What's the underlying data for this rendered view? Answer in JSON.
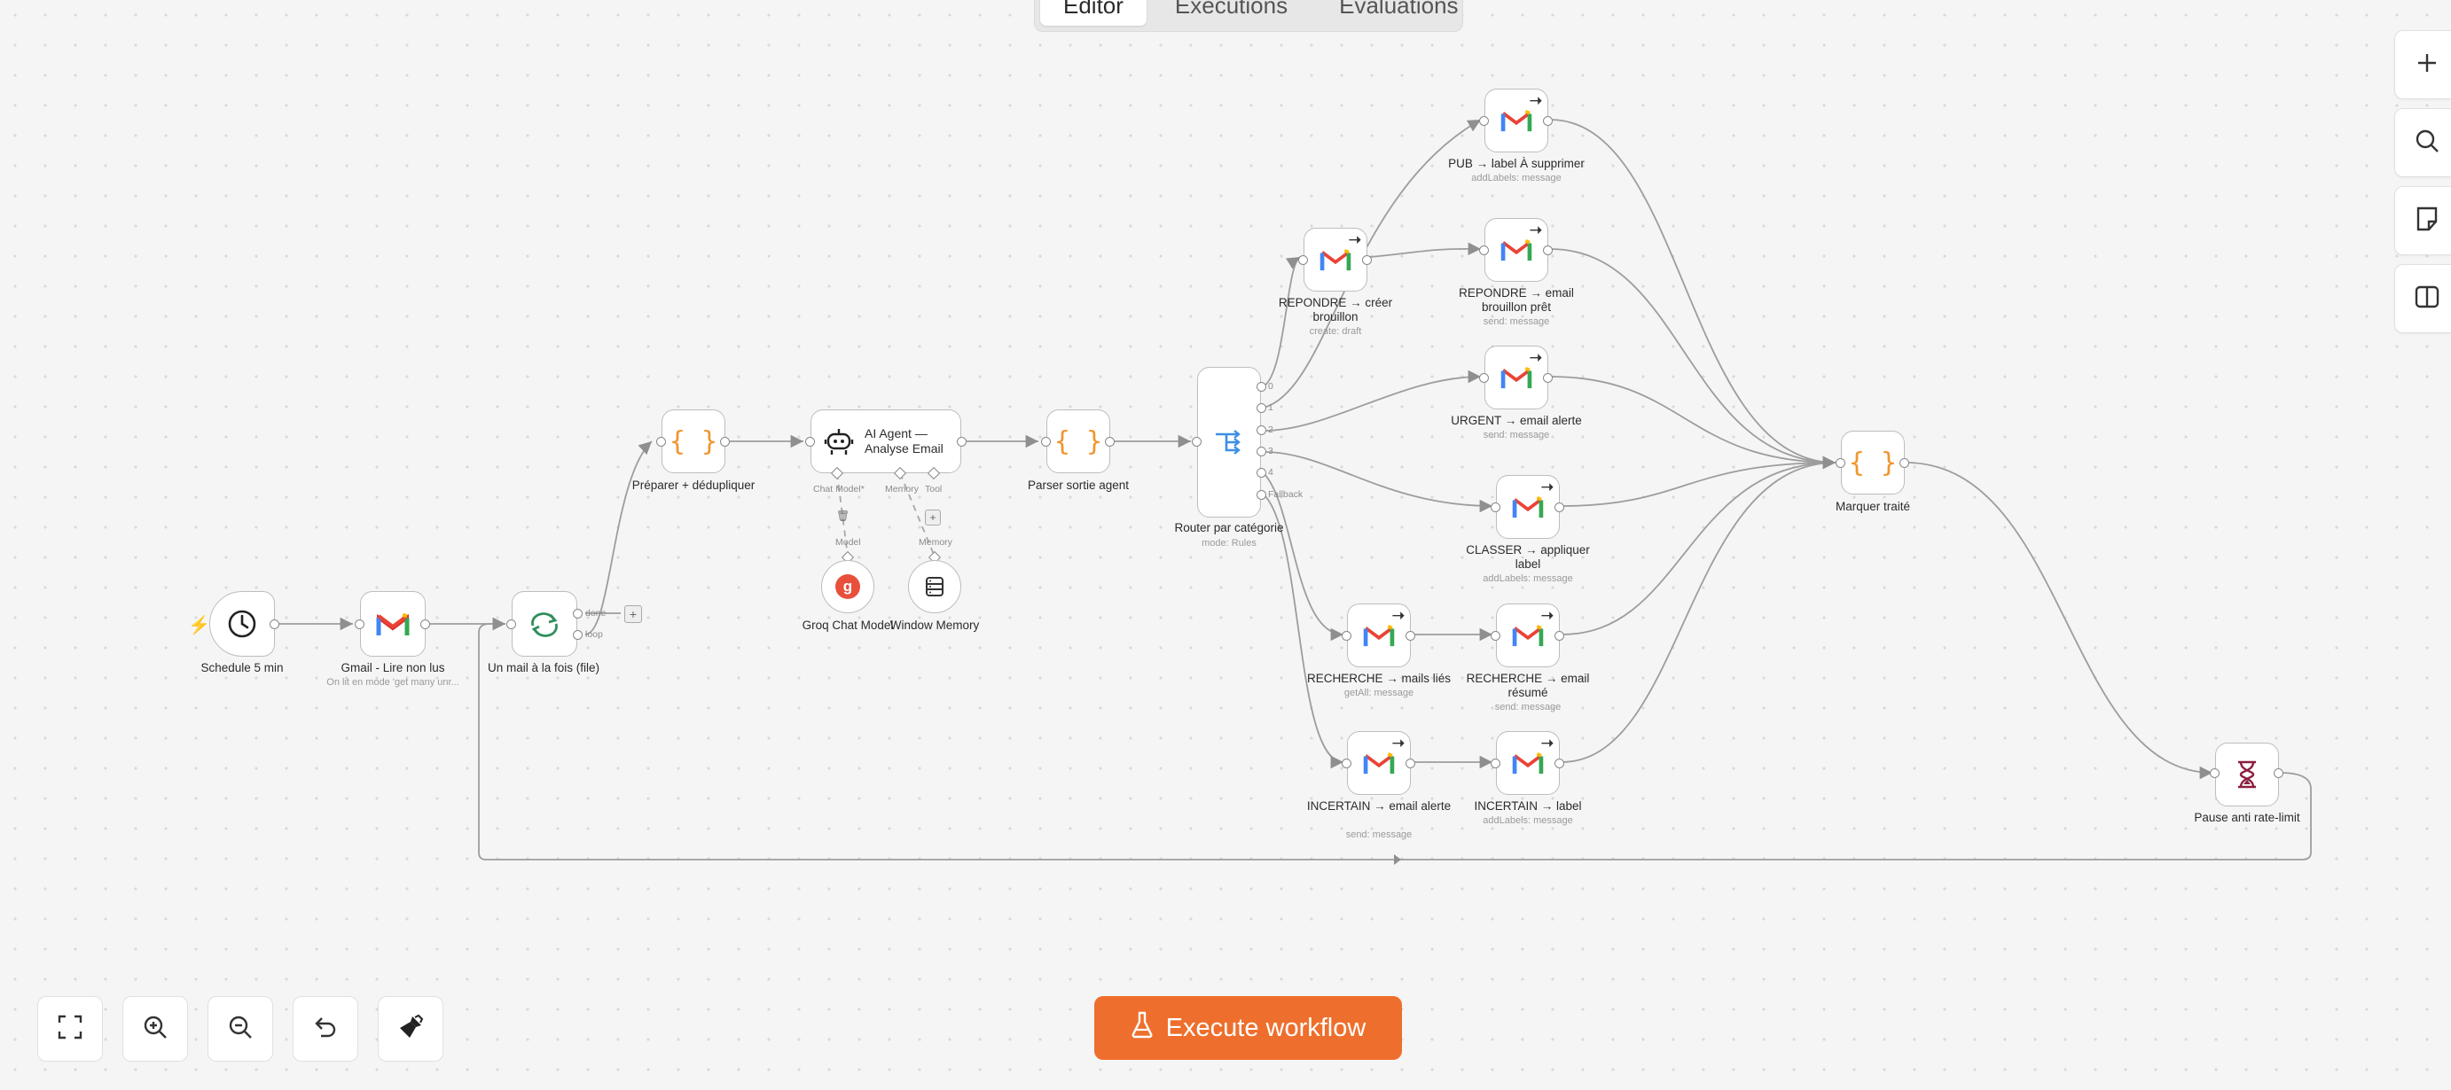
{
  "tabs": [
    {
      "label": "Editor",
      "active": true
    },
    {
      "label": "Executions",
      "active": false
    },
    {
      "label": "Evaluations",
      "active": false
    }
  ],
  "nodes": {
    "schedule": {
      "label": "Schedule 5 min",
      "icon": "clock-icon"
    },
    "gmail_read": {
      "label": "Gmail - Lire non lus",
      "sub": "On lit en mode 'get many unr...",
      "icon": "gmail-icon"
    },
    "loop": {
      "label": "Un mail à la fois (file)",
      "icon": "loop-icon",
      "out_done": "done",
      "out_loop": "loop"
    },
    "prepare": {
      "label": "Préparer + dédupliquer",
      "icon": "code-braces-icon"
    },
    "agent": {
      "title_line1": "AI Agent —",
      "title_line2": "Analyse Email",
      "icon": "robot-icon",
      "port_chat_model": "Chat Model*",
      "port_memory": "Memory",
      "port_tool": "Tool"
    },
    "groq": {
      "label": "Groq Chat Model",
      "port": "Model",
      "icon": "groq-icon"
    },
    "memory": {
      "label": "Window Memory",
      "port": "Memory",
      "icon": "database-icon"
    },
    "parse": {
      "label": "Parser sortie agent",
      "icon": "code-braces-icon"
    },
    "router": {
      "label": "Router par catégorie",
      "sub": "mode: Rules",
      "icon": "router-icon",
      "outputs": [
        "0",
        "1",
        "2",
        "3",
        "4",
        "Fallback"
      ]
    },
    "pub": {
      "label": "PUB → label À supprimer",
      "sub": "addLabels: message"
    },
    "repondre_draft": {
      "label": "REPONDRE → créer brouillon",
      "sub": "create: draft"
    },
    "repondre_email": {
      "label": "REPONDRE → email brouillon prêt",
      "sub": "send: message"
    },
    "urgent": {
      "label": "URGENT → email alerte",
      "sub": "send: message"
    },
    "classer": {
      "label": "CLASSER → appliquer label",
      "sub": "addLabels: message"
    },
    "recherche_mails": {
      "label": "RECHERCHE → mails liés",
      "sub": "getAll: message"
    },
    "recherche_email": {
      "label": "RECHERCHE → email résumé",
      "sub": "send: message"
    },
    "incertain_email": {
      "label": "INCERTAIN → email alerte",
      "sub": "send: message"
    },
    "incertain_label": {
      "label": "INCERTAIN → label",
      "sub": "addLabels: message"
    },
    "marquer": {
      "label": "Marquer traité",
      "icon": "code-braces-icon"
    },
    "pause": {
      "label": "Pause anti rate-limit",
      "icon": "hourglass-icon"
    }
  },
  "right_toolbar": [
    "plus-icon",
    "search-icon",
    "sticky-note-icon",
    "panel-icon"
  ],
  "bottom_toolbar": [
    "fit-view-icon",
    "zoom-in-icon",
    "zoom-out-icon",
    "undo-icon",
    "tidy-up-icon"
  ],
  "execute_button": {
    "label": "Execute workflow",
    "icon": "flask-icon"
  },
  "colors": {
    "accent": "#ee6f2d",
    "code": "#f0962e",
    "router": "#3d8fe5",
    "loop": "#2f8f5b",
    "groq": "#e8503c",
    "pause": "#8b1e3f"
  }
}
